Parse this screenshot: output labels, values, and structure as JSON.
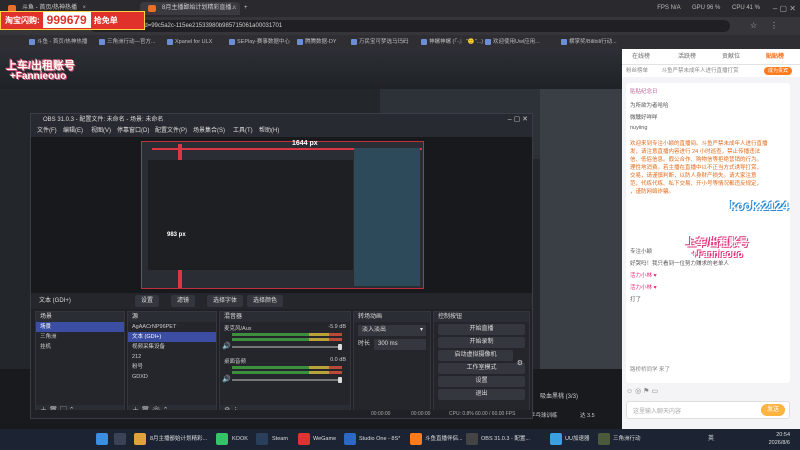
{
  "browser": {
    "tabs": [
      {
        "label": "斗鱼 - 首页/热神热播"
      },
      {
        "label": "8月主播鄙始计划精彩直播..."
      }
    ],
    "hud": {
      "fps": "FPS  N/A",
      "gpu": "GPU  96 %",
      "cpu": "CPU  41 %"
    },
    "url": "...6171dyshid=99c5a2c-115ee21533980b985715061a00031701",
    "bookmarks": [
      "斗鱼 - 首页/热神热播",
      "三角洲行动—官方...",
      "Xpanel for ULX",
      "SEPlay-赛事数据中心",
      "腾腾数据-DY",
      "万民宝可梦选马玛码",
      "神螺神螺 (『-』 \"🙂\"...)",
      "欢迎使用Uwl应用...",
      "横掌奖/Bilibili行动..."
    ]
  },
  "promo": {
    "prefix": "淘宝闪购:",
    "number": "999679",
    "suffix": "抢免单"
  },
  "stream_overlay": {
    "title_line1": "上车/出租账号",
    "title_line2": "+Fannieouo"
  },
  "obs": {
    "title": "OBS 31.0.3 - 配置文件: 未命名 - 场景: 未命名",
    "menu": [
      "文件(F)",
      "编辑(E)",
      "视图(V)",
      "停靠窗口(D)",
      "配置文件(P)",
      "场景集合(S)",
      "工具(T)",
      "帮助(H)"
    ],
    "preview_width_label": "1644 px",
    "preview_height_label": "983 px",
    "source_toolbar": {
      "selected_source": "文本 (GDI+)",
      "buttons": [
        "设置",
        "滤镜",
        "选择字体",
        "选择颜色"
      ]
    },
    "scenes": {
      "header": "场景",
      "items": [
        "场景",
        "三角洲",
        "挂机"
      ]
    },
    "sources": {
      "header": "源",
      "items": [
        "AgAACrNP96PET",
        "文本 (GDI+)",
        "视频采集设备",
        "212",
        "粉号",
        "GDXD"
      ]
    },
    "mixer": {
      "header": "混音器",
      "channels": [
        {
          "name": "麦克风/Aux",
          "db": "-5.9 dB"
        },
        {
          "name": "桌面音频",
          "db": "0.0 dB"
        }
      ]
    },
    "transitions": {
      "header": "转场动画",
      "type": "淡入淡出",
      "duration_label": "时长",
      "duration_value": "300 ms"
    },
    "controls": {
      "header": "控制按钮",
      "buttons": [
        "开始直播",
        "开始录制",
        "启动虚拟摄像机",
        "工作室模式",
        "设置",
        "退出"
      ]
    },
    "status": {
      "timer1": "00:00:00",
      "timer2": "00:00:00",
      "cpu_fps": "CPU: 0.8%  60.00 / 60.00 FPS"
    }
  },
  "chat": {
    "tabs": [
      "在线榜",
      "活跃榜",
      "贡献位",
      "贴贴榜"
    ],
    "sub_left": "粉丝榜单",
    "sub_mid": "斗鱼严禁未成年人进行直播打赏",
    "sub_badge": "成为贵宾",
    "pinned": "贴贴纪念日",
    "messages": [
      {
        "text": "为所欲为者哈哈",
        "notice": false
      },
      {
        "text": "微醺好咩咩",
        "notice": false
      },
      {
        "text": "nuyiing",
        "notice": false
      },
      {
        "text": "欢迎来到专注小颖的直播间。斗鱼严禁未成年人进行直播",
        "notice": true
      },
      {
        "text": "发，请注意直播内容进行 24 小时巡查，禁止传播违法",
        "notice": true
      },
      {
        "text": "信、低俗信息。假公合作、购物信等拒绝营销的行为。",
        "notice": true
      },
      {
        "text": "理性地消费。若主播在直播中以不正当方式诱导打赏，",
        "notice": true
      },
      {
        "text": "交易，请谨慎判断，以防人身财产损失。请大家注意",
        "notice": true
      },
      {
        "text": "范，代练代练、私下交易、开小号等情况都违反规定，",
        "notice": true
      },
      {
        "text": "，谨防网络诈骗。",
        "notice": true
      },
      {
        "text": "专注小颖",
        "notice": false
      },
      {
        "text": "好哭吗！我只看到一位努力赚求的老单人",
        "notice": false
      },
      {
        "text": "活力小林  ♥",
        "notice": false
      },
      {
        "text": "活力小林  ♥",
        "notice": false
      },
      {
        "text": "打了",
        "notice": false
      }
    ],
    "enter_notice": "路桥桥同学 来了",
    "input_placeholder": "这里输入聊天内容",
    "send_label": "发送",
    "banner_text": "kook:2124",
    "overlay_line1": "上车/出租账号",
    "overlay_line2": "+Fannieouo"
  },
  "stream_bottom": {
    "gift_caption": "吸血黑桃 (3/3)",
    "viewer_label": "乒乓球训练",
    "score": "达 3.5"
  },
  "taskbar": {
    "items": [
      "8月主播鄙始计划精彩...",
      "KOOK",
      "Steam",
      "WeGame",
      "Studio One - 8S*",
      "斗鱼直播伴侣...",
      "OBS 31.0.3 - 配置...",
      "UU加速器",
      "三角洲行动"
    ],
    "lang": "英",
    "time": "20:54",
    "date": "2026/8/6"
  }
}
